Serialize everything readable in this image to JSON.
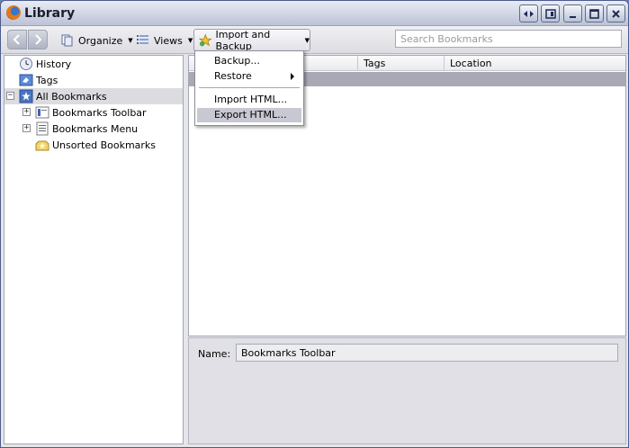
{
  "window": {
    "title": "Library"
  },
  "toolbar": {
    "organize_label": "Organize",
    "views_label": "Views",
    "import_backup_label": "Import and Backup",
    "search_placeholder": "Search Bookmarks"
  },
  "sidebar": {
    "items": [
      {
        "label": "History",
        "icon": "history-clock-icon"
      },
      {
        "label": "Tags",
        "icon": "tag-icon"
      },
      {
        "label": "All Bookmarks",
        "icon": "star-icon",
        "selected": true
      },
      {
        "label": "Bookmarks Toolbar",
        "icon": "toolbar-folder-icon"
      },
      {
        "label": "Bookmarks Menu",
        "icon": "menu-folder-icon"
      },
      {
        "label": "Unsorted Bookmarks",
        "icon": "unsorted-folder-icon"
      }
    ]
  },
  "list": {
    "columns": [
      "Tags",
      "Location"
    ],
    "row_partial_text": "s"
  },
  "details": {
    "name_label": "Name:",
    "name_value": "Bookmarks Toolbar"
  },
  "menu": {
    "items": [
      "Backup...",
      "Restore",
      "Import HTML...",
      "Export HTML..."
    ]
  },
  "colors": {
    "selection": "#dcdce0",
    "menu_hover": "#c8c8d2",
    "list_selection": "#a9a9b5"
  }
}
